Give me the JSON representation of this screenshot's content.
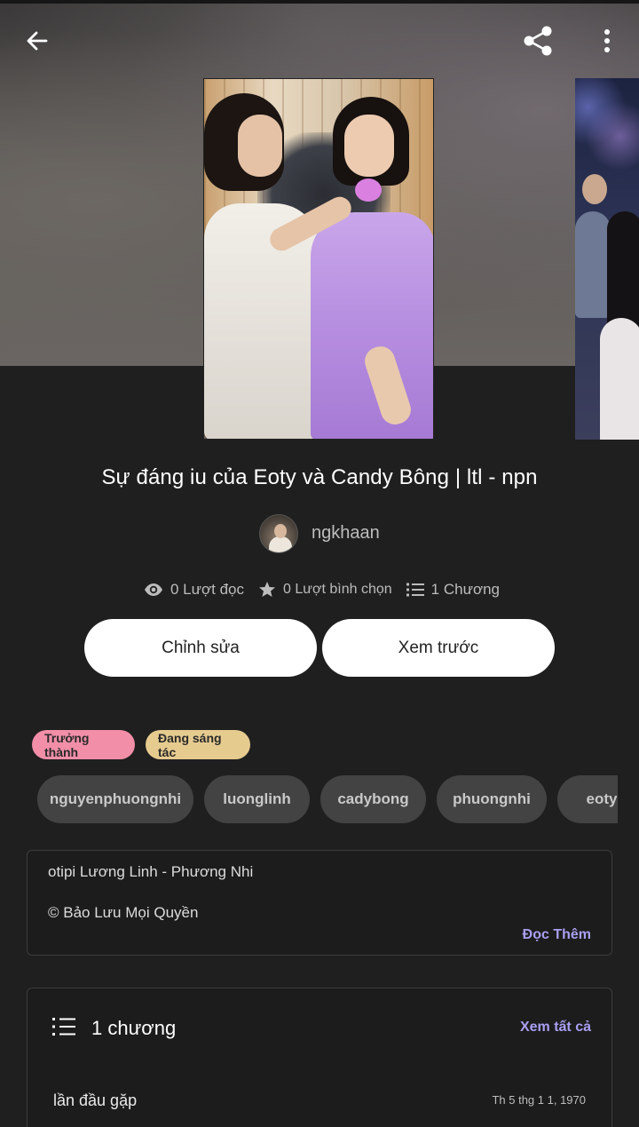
{
  "story": {
    "title": "Sự đáng iu của Eoty và Candy Bông | ltl - npn",
    "author": "ngkhaan"
  },
  "topbar": {
    "back_icon": "arrow-left-icon",
    "share_icon": "share-icon",
    "more_icon": "more-vertical-icon"
  },
  "stats": {
    "reads": "0 Lượt đọc",
    "votes": "0 Lượt bình chọn",
    "chapters": "1 Chương"
  },
  "actions": {
    "edit_label": "Chỉnh sửa",
    "preview_label": "Xem trước"
  },
  "badges": {
    "mature": "Trưởng thành",
    "ongoing": "Đang sáng tác"
  },
  "badge_colors": {
    "mature": "#f28ea8",
    "ongoing": "#e6cb8f"
  },
  "tags": [
    "nguyenphuongnhi",
    "luonglinh",
    "cadybong",
    "phuongnhi",
    "eoty"
  ],
  "description": {
    "line1": "otipi Lương Linh - Phương Nhi",
    "line2": "© Bảo Lưu Mọi Quyền",
    "read_more": "Đọc Thêm"
  },
  "chapters": {
    "count_label": "1 chương",
    "see_all": "Xem tất cả",
    "items": [
      {
        "title": "lần đầu gặp",
        "date": "Th 5 thg 1 1, 1970"
      }
    ]
  },
  "accent_color": "#a99ff2"
}
